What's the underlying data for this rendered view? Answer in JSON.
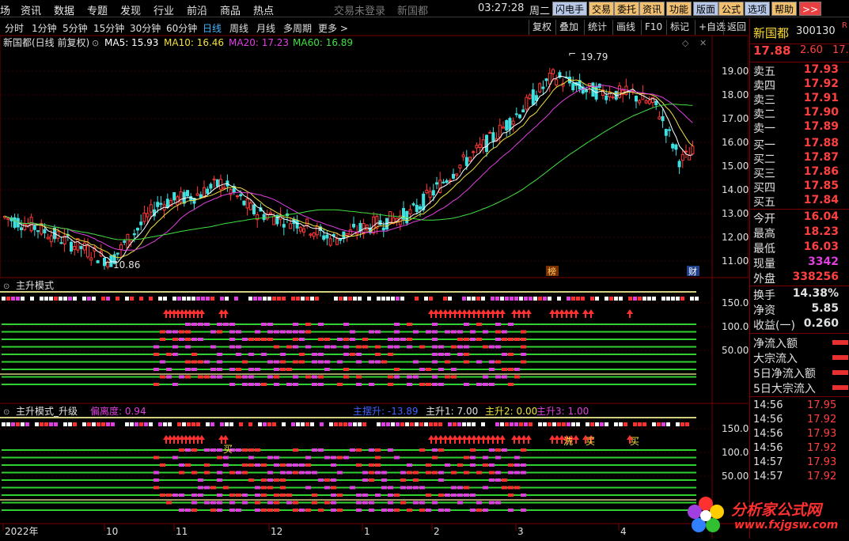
{
  "menu": {
    "items": [
      "场",
      "资讯",
      "数据",
      "专题",
      "发现",
      "行业",
      "前沿",
      "商品",
      "热点"
    ],
    "login_status": "交易未登录",
    "stock_name": "新国都",
    "time": "03:27:28",
    "weekday": "周二",
    "buttons": [
      "闪电手",
      "交易",
      "委托",
      "资讯",
      "功能",
      "版面",
      "公式",
      "选项",
      "帮助"
    ],
    "more_button": ">>"
  },
  "periods": {
    "items": [
      "分时",
      "1分钟",
      "5分钟",
      "15分钟",
      "30分钟",
      "60分钟",
      "日线",
      "周线",
      "月线",
      "多周期",
      "更多 >"
    ],
    "active": "日线",
    "right_buttons": [
      "复权",
      "叠加",
      "统计",
      "画线",
      "F10",
      "标记",
      "+自选",
      "返回"
    ]
  },
  "main_chart": {
    "title": "新国都(日线 前复权)",
    "ma_legend": [
      {
        "label": "MA5: 15.93",
        "color": "#ffffff"
      },
      {
        "label": "MA10: 16.46",
        "color": "#f0e040"
      },
      {
        "label": "MA20: 17.23",
        "color": "#e040e0"
      },
      {
        "label": "MA60: 16.89",
        "color": "#40e040"
      }
    ],
    "price_axis": [
      "19.00",
      "18.00",
      "17.00",
      "16.00",
      "15.00",
      "14.00",
      "13.00",
      "12.00",
      "11.00"
    ],
    "high_label": "19.79",
    "low_label": "10.86",
    "badge_bang": "榜",
    "badge_cai": "财"
  },
  "panel1": {
    "title": "主升模式",
    "axis": [
      "150.00",
      "100.00",
      "50.00"
    ]
  },
  "panel2": {
    "title": "主升模式_升级",
    "deviation_label": "偏离度: 0.94",
    "line1_label": "主摆升: -13.89",
    "line2_label": "主升1: 7.00",
    "line3_label": "主升2: 0.00",
    "line4_label": "主升3: 1.00",
    "axis": [
      "150.00",
      "100.00",
      "50.00"
    ],
    "signal_buy": "买",
    "signal_wash": "洗"
  },
  "time_axis": [
    "2022年",
    "10",
    "11",
    "12",
    "1",
    "2",
    "3",
    "4"
  ],
  "quote": {
    "name": "新国都",
    "code": "300130",
    "price": "17.88",
    "change": "2.60",
    "pct_partial": "17.",
    "asks": [
      {
        "label": "卖五",
        "value": "17.93"
      },
      {
        "label": "卖四",
        "value": "17.92"
      },
      {
        "label": "卖三",
        "value": "17.91"
      },
      {
        "label": "卖二",
        "value": "17.90"
      },
      {
        "label": "卖一",
        "value": "17.89"
      }
    ],
    "bids": [
      {
        "label": "买一",
        "value": "17.88"
      },
      {
        "label": "买二",
        "value": "17.87"
      },
      {
        "label": "买三",
        "value": "17.86"
      },
      {
        "label": "买四",
        "value": "17.85"
      },
      {
        "label": "买五",
        "value": "17.84"
      }
    ],
    "stats": [
      {
        "label": "今开",
        "value": "16.04",
        "color": "#ff4040"
      },
      {
        "label": "最高",
        "value": "18.23",
        "color": "#ff4040"
      },
      {
        "label": "最低",
        "value": "16.03",
        "color": "#ff4040"
      },
      {
        "label": "现量",
        "value": "3342",
        "color": "#e040e0"
      },
      {
        "label": "外盘",
        "value": "338256",
        "color": "#ff4040"
      }
    ],
    "stats2": [
      {
        "label": "换手",
        "value": "14.38%"
      },
      {
        "label": "净资",
        "value": "5.85"
      },
      {
        "label": "收益(一)",
        "value": "0.260"
      }
    ],
    "flows": [
      "净流入额",
      "大宗流入",
      "5日净流入额",
      "5日大宗流入"
    ],
    "ticks": [
      {
        "time": "14:56",
        "value": "17.95"
      },
      {
        "time": "14:56",
        "value": "17.92"
      },
      {
        "time": "14:56",
        "value": "17.93"
      },
      {
        "time": "14:56",
        "value": "17.92"
      },
      {
        "time": "14:57",
        "value": "17.93"
      },
      {
        "time": "14:57",
        "value": "17.92"
      }
    ]
  },
  "watermark": {
    "title": "分析家公式网",
    "url": "www.fxjgsw.com"
  }
}
